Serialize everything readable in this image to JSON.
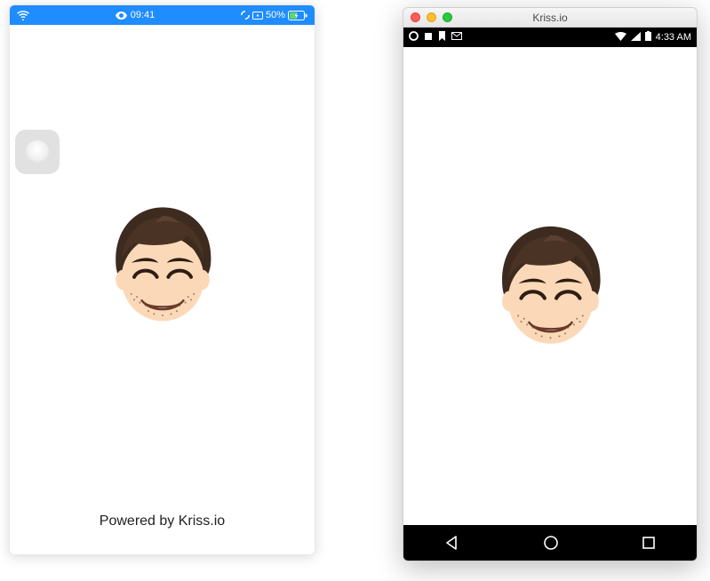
{
  "ios": {
    "status": {
      "time": "09:41",
      "battery_percent": "50%"
    },
    "footer": "Powered by Kriss.io"
  },
  "window": {
    "title": "Kriss.io"
  },
  "android": {
    "status": {
      "time": "4:33 AM"
    }
  }
}
